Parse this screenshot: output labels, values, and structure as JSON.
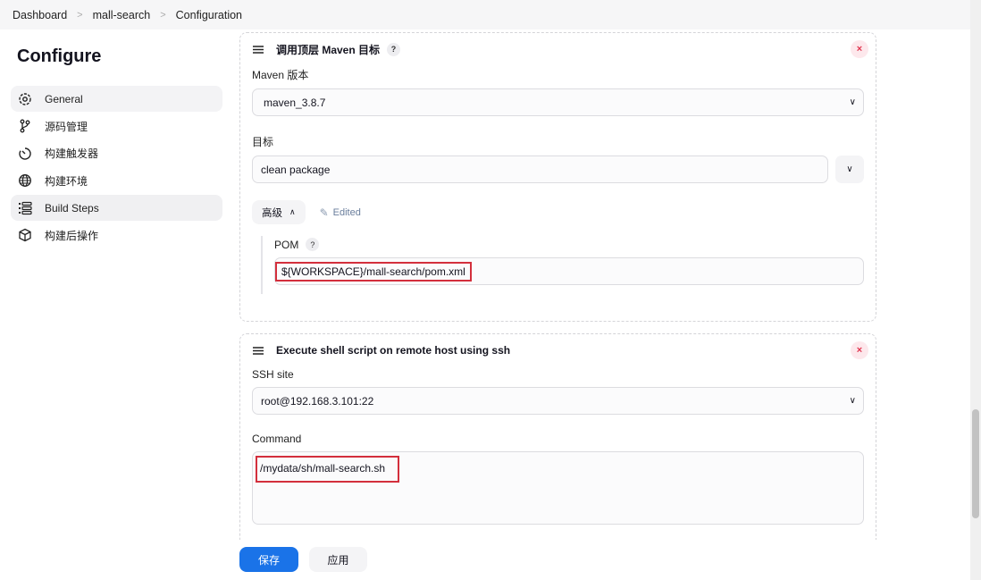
{
  "breadcrumb": [
    "Dashboard",
    "mall-search",
    "Configuration"
  ],
  "page_title": "Configure",
  "sidebar": {
    "items": [
      {
        "label": "General",
        "icon": "gear-icon"
      },
      {
        "label": "源码管理",
        "icon": "branch-icon"
      },
      {
        "label": "构建触发器",
        "icon": "timer-icon"
      },
      {
        "label": "构建环境",
        "icon": "globe-icon"
      },
      {
        "label": "Build Steps",
        "icon": "list-icon"
      },
      {
        "label": "构建后操作",
        "icon": "package-icon"
      }
    ],
    "active": "Build Steps"
  },
  "maven_step": {
    "title": "调用顶层 Maven 目标",
    "help": "?",
    "maven_version_label": "Maven 版本",
    "maven_version": "maven_3.8.7",
    "goals_label": "目标",
    "goals": "clean package",
    "advanced_label": "高级",
    "edited_label": "Edited",
    "pom_label": "POM",
    "pom_value": "${WORKSPACE}/mall-search/pom.xml",
    "close": "×"
  },
  "ssh_step": {
    "title": "Execute shell script on remote host using ssh",
    "ssh_site_label": "SSH site",
    "ssh_site": "root@192.168.3.101:22",
    "command_label": "Command",
    "command": "/mydata/sh/mall-search.sh",
    "close": "×"
  },
  "footer": {
    "save": "保存",
    "apply": "应用"
  },
  "colors": {
    "primary": "#1a73e8",
    "danger": "#d32f3c"
  }
}
